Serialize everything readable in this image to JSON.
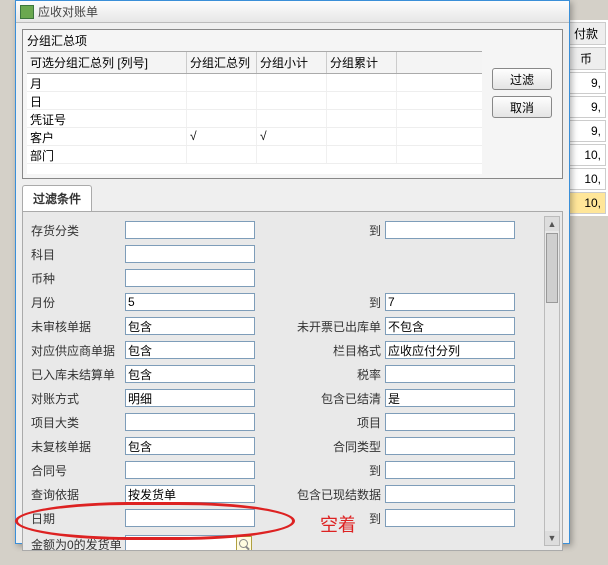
{
  "window": {
    "title": "应收对账单"
  },
  "group": {
    "title": "分组汇总项",
    "headers": [
      "可选分组汇总列 [列号]",
      "分组汇总列",
      "分组小计",
      "分组累计"
    ],
    "rows": [
      {
        "name": "月",
        "sum": "",
        "sub": "",
        "acc": ""
      },
      {
        "name": "日",
        "sum": "",
        "sub": "",
        "acc": ""
      },
      {
        "name": "凭证号",
        "sum": "",
        "sub": "",
        "acc": ""
      },
      {
        "name": "客户",
        "sum": "√",
        "sub": "√",
        "acc": ""
      },
      {
        "name": "部门",
        "sum": "",
        "sub": "",
        "acc": ""
      }
    ]
  },
  "buttons": {
    "filter": "过滤",
    "cancel": "取消"
  },
  "tab": {
    "label": "过滤条件"
  },
  "fields": {
    "left": [
      {
        "label": "存货分类",
        "value": ""
      },
      {
        "label": "科目",
        "value": ""
      },
      {
        "label": "币种",
        "value": ""
      },
      {
        "label": "月份",
        "value": "5"
      },
      {
        "label": "未审核单据",
        "value": "包含"
      },
      {
        "label": "对应供应商单据",
        "value": "包含"
      },
      {
        "label": "已入库未结算单",
        "value": "包含"
      },
      {
        "label": "对账方式",
        "value": "明细"
      },
      {
        "label": "项目大类",
        "value": ""
      },
      {
        "label": "未复核单据",
        "value": "包含"
      },
      {
        "label": "合同号",
        "value": ""
      },
      {
        "label": "查询依据",
        "value": "按发货单"
      },
      {
        "label": "日期",
        "value": ""
      }
    ],
    "right": [
      {
        "label": "到",
        "value": ""
      },
      {
        "label": "",
        "value": ""
      },
      {
        "label": "",
        "value": ""
      },
      {
        "label": "到",
        "value": "7"
      },
      {
        "label": "未开票已出库单",
        "value": "不包含"
      },
      {
        "label": "栏目格式",
        "value": "应收应付分列"
      },
      {
        "label": "税率",
        "value": ""
      },
      {
        "label": "包含已结清",
        "value": "是"
      },
      {
        "label": "项目",
        "value": ""
      },
      {
        "label": "合同类型",
        "value": ""
      },
      {
        "label": "到",
        "value": ""
      },
      {
        "label": "包含已现结数据",
        "value": ""
      },
      {
        "label": "到",
        "value": ""
      }
    ],
    "bottom": {
      "label": "金额为0的发货单",
      "value": ""
    }
  },
  "annotation": "空着",
  "bg": {
    "headers": [
      "付款",
      "币"
    ],
    "vals": [
      "9,",
      "9,",
      "9,",
      "10,",
      "10,",
      "10,"
    ]
  }
}
